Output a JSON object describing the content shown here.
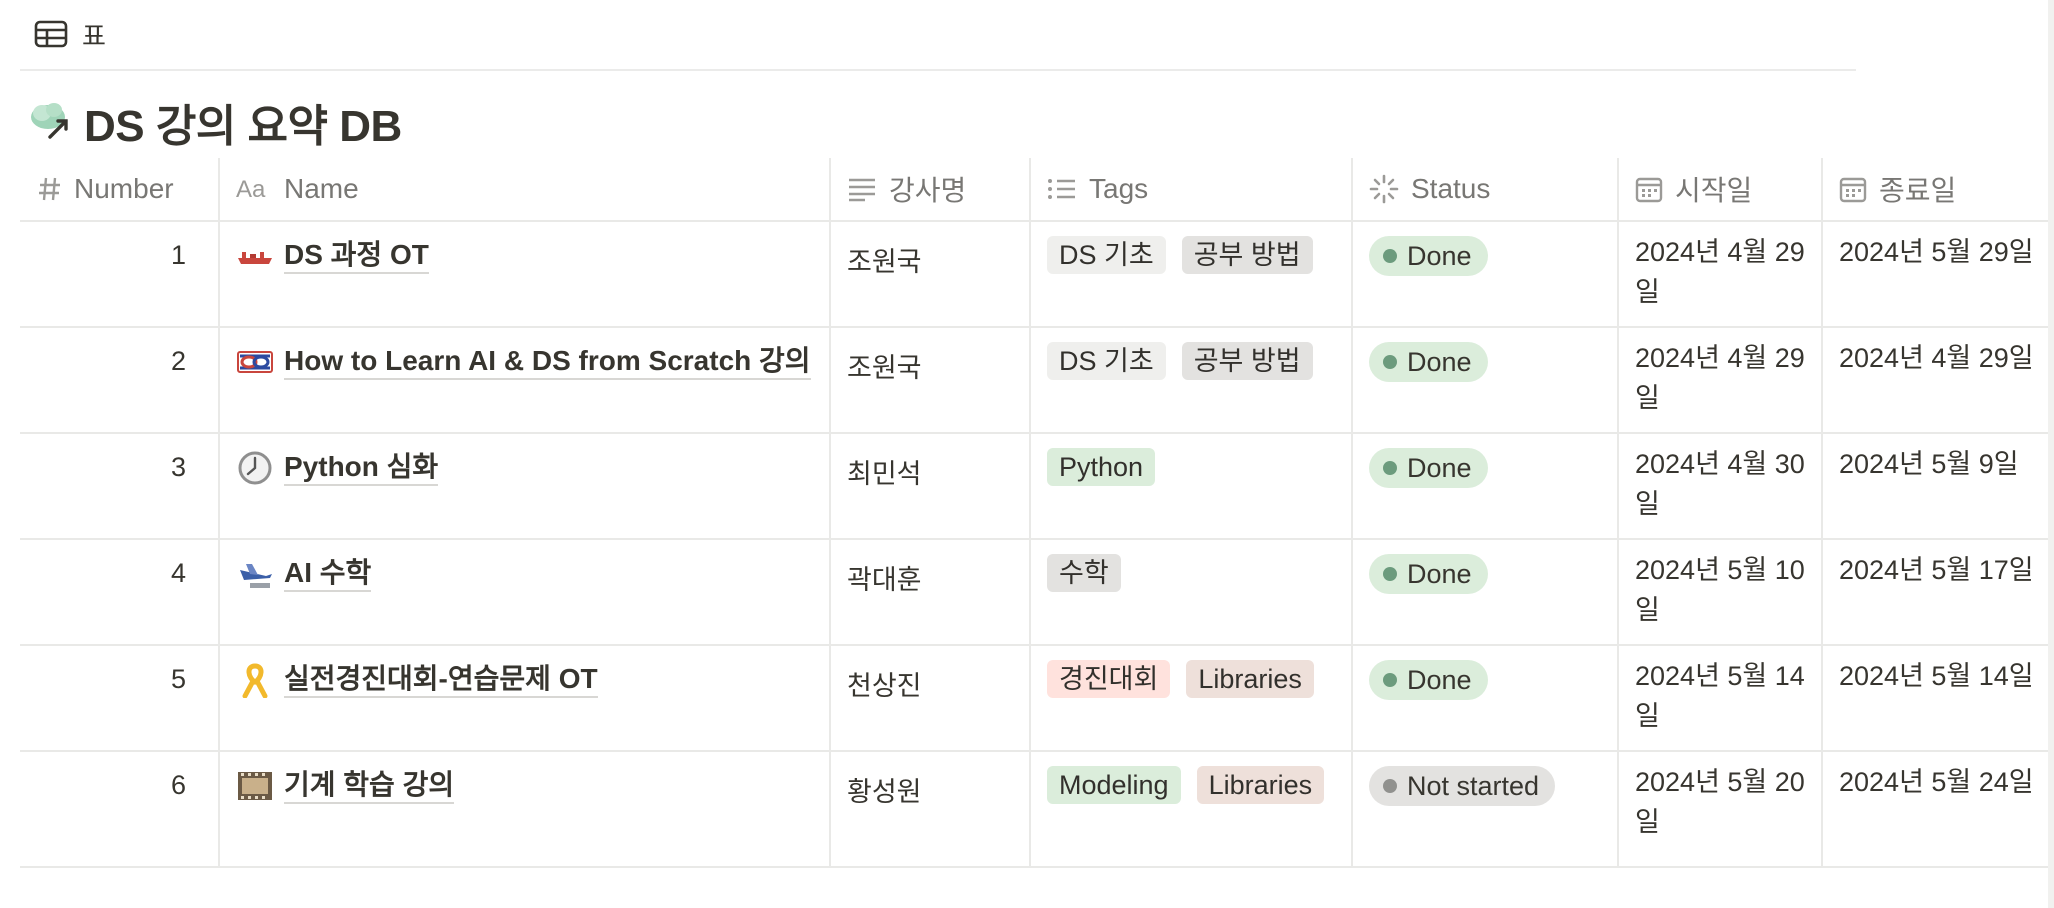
{
  "view": {
    "label": "표",
    "icon": "table-icon"
  },
  "title": {
    "text": "DS 강의 요약 DB",
    "icon": "cloud-link-icon"
  },
  "columns": {
    "number": "Number",
    "name": "Name",
    "instructor": "강사명",
    "tags": "Tags",
    "status": "Status",
    "start": "시작일",
    "end": "종료일"
  },
  "rows": [
    {
      "number": "1",
      "icon": "red-boat-icon",
      "name": "DS 과정 OT",
      "instructor": "조원국",
      "tags": [
        {
          "label": "DS 기초",
          "color": "#efefed"
        },
        {
          "label": "공부 방법",
          "color": "#e3e2e0"
        }
      ],
      "status": {
        "label": "Done",
        "bg": "#dbeddb",
        "dot": "#6c9b7d"
      },
      "start": "2024년 4월 29일",
      "end": "2024년 5월 29일"
    },
    {
      "number": "2",
      "icon": "flag-knot-icon",
      "name": "How to Learn AI & DS from Scratch 강의",
      "instructor": "조원국",
      "tags": [
        {
          "label": "DS 기초",
          "color": "#efefed"
        },
        {
          "label": "공부 방법",
          "color": "#e3e2e0"
        }
      ],
      "status": {
        "label": "Done",
        "bg": "#dbeddb",
        "dot": "#6c9b7d"
      },
      "start": "2024년 4월 29일",
      "end": "2024년 4월 29일"
    },
    {
      "number": "3",
      "icon": "clock-icon",
      "name": "Python 심화",
      "instructor": "최민석",
      "tags": [
        {
          "label": "Python",
          "color": "#dbeddb"
        }
      ],
      "status": {
        "label": "Done",
        "bg": "#dbeddb",
        "dot": "#6c9b7d"
      },
      "start": "2024년 4월 30일",
      "end": "2024년 5월 9일"
    },
    {
      "number": "4",
      "icon": "airplane-icon",
      "name": "AI 수학",
      "instructor": "곽대훈",
      "tags": [
        {
          "label": "수학",
          "color": "#e3e2e0"
        }
      ],
      "status": {
        "label": "Done",
        "bg": "#dbeddb",
        "dot": "#6c9b7d"
      },
      "start": "2024년 5월 10일",
      "end": "2024년 5월 17일"
    },
    {
      "number": "5",
      "icon": "ribbon-icon",
      "name": "실전경진대회-연습문제 OT",
      "instructor": "천상진",
      "tags": [
        {
          "label": "경진대회",
          "color": "#ffe2dd"
        },
        {
          "label": "Libraries",
          "color": "#eee0da"
        }
      ],
      "status": {
        "label": "Done",
        "bg": "#dbeddb",
        "dot": "#6c9b7d"
      },
      "start": "2024년 5월 14일",
      "end": "2024년 5월 14일"
    },
    {
      "number": "6",
      "icon": "film-icon",
      "name": "기계 학습 강의",
      "instructor": "황성원",
      "tags": [
        {
          "label": "Modeling",
          "color": "#dbeddb"
        },
        {
          "label": "Libraries",
          "color": "#eee0da"
        }
      ],
      "status": {
        "label": "Not started",
        "bg": "#e3e2e0",
        "dot": "#91918e"
      },
      "start": "2024년 5월 20일",
      "end": "2024년 5월 24일"
    }
  ]
}
